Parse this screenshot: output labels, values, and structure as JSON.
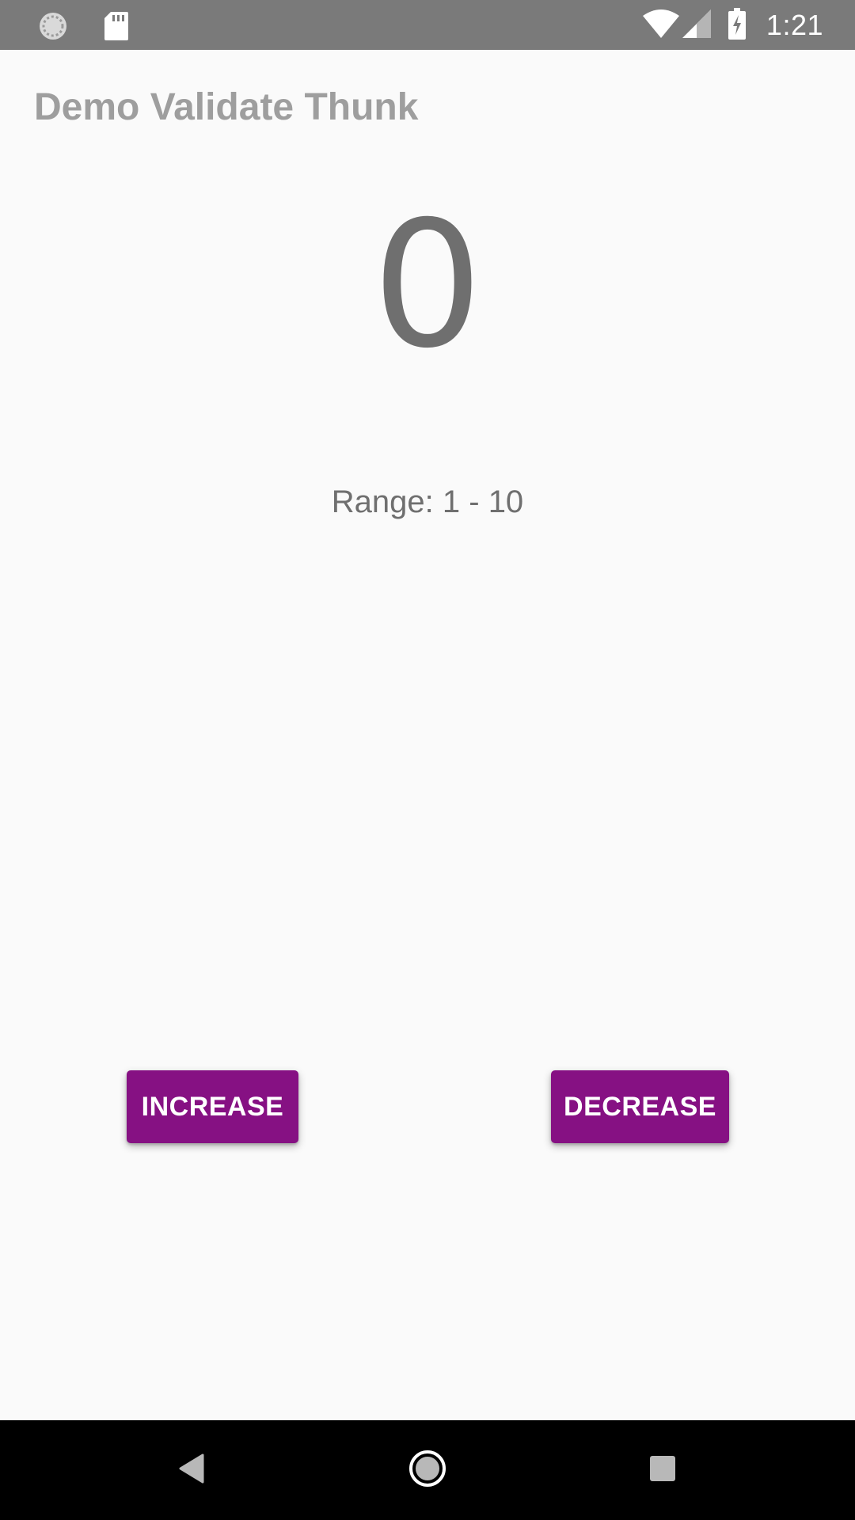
{
  "status_bar": {
    "time": "1:21",
    "icons": [
      "sync-icon",
      "sd-card-icon",
      "wifi-icon",
      "signal-icon",
      "battery-charging-icon"
    ],
    "background_color": "#7a7a7a"
  },
  "app": {
    "title": "Demo Validate Thunk"
  },
  "counter": {
    "value": "0",
    "range_text": "Range: 1 - 10"
  },
  "buttons": {
    "increase_label": "INCREASE",
    "decrease_label": "DECREASE",
    "color": "#861183"
  },
  "nav_bar": {
    "icons": [
      "back-icon",
      "home-icon",
      "recents-icon"
    ]
  }
}
